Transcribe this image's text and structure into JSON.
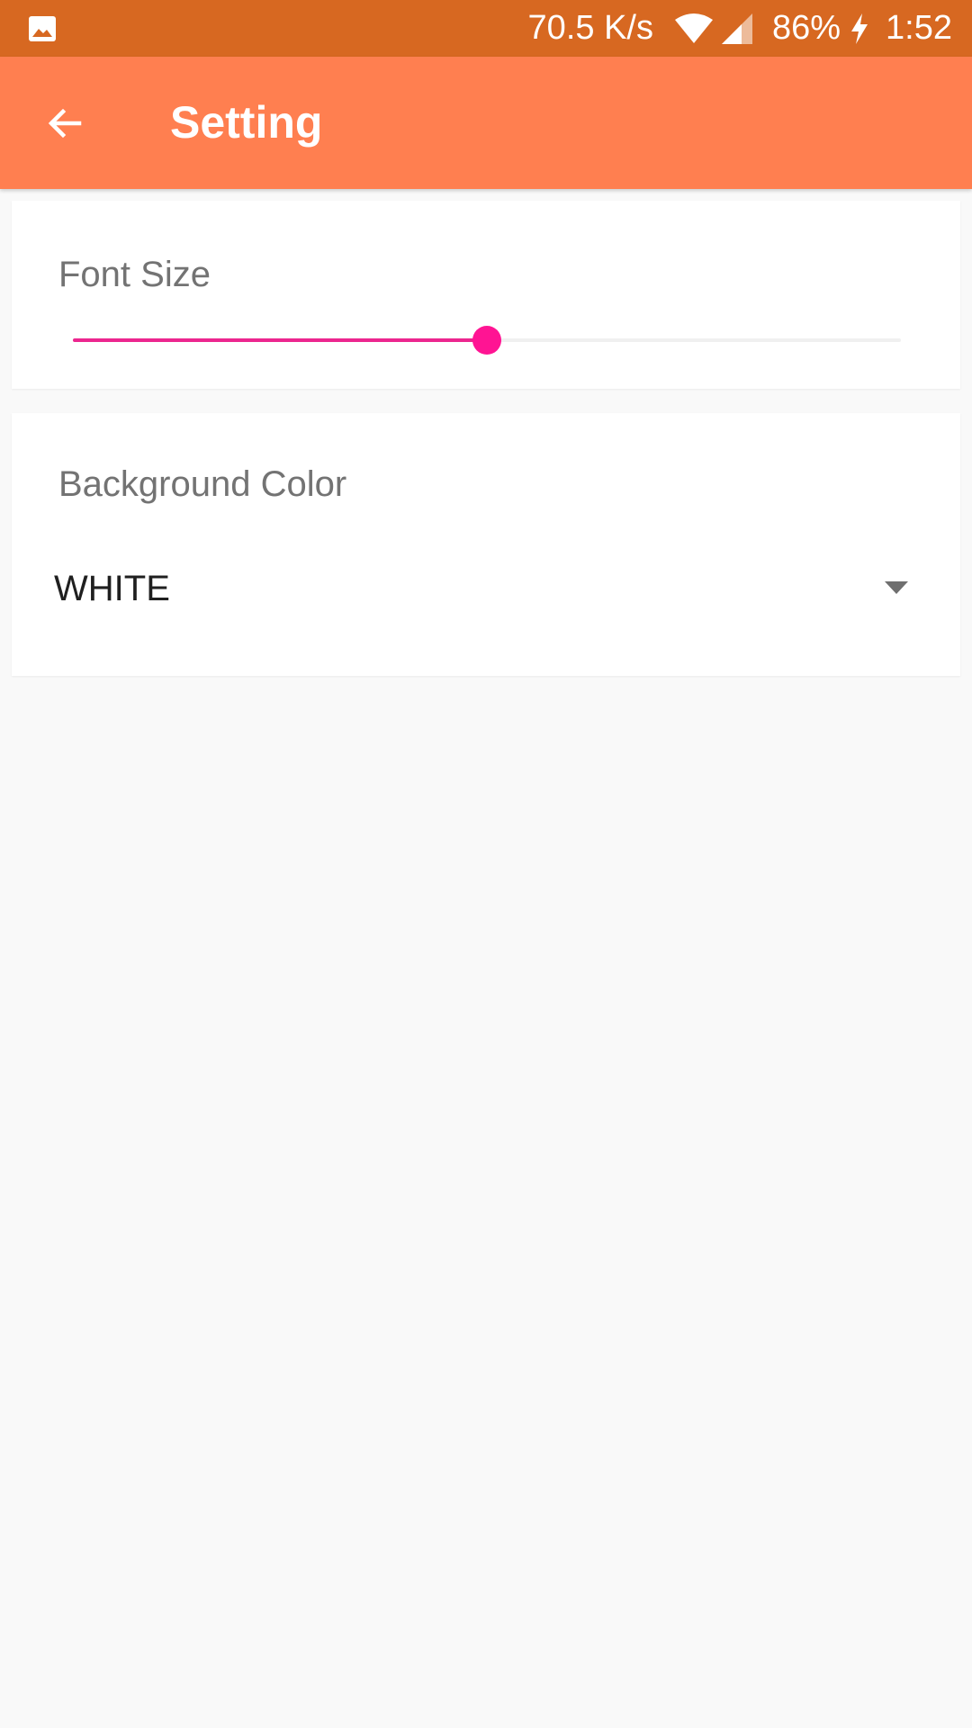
{
  "status_bar": {
    "net_speed": "70.5 K/s",
    "battery": "86%",
    "time": "1:52",
    "icons": [
      "gallery-icon",
      "wifi-icon",
      "signal-icon",
      "charging-icon"
    ]
  },
  "app_bar": {
    "title": "Setting",
    "back_icon": "arrow-left-icon"
  },
  "font_size": {
    "label": "Font Size",
    "slider_fraction": 0.5
  },
  "background_color": {
    "label": "Background Color",
    "selected": "WHITE",
    "dropdown_icon": "caret-down-icon"
  },
  "colors": {
    "status_bar": "#d76821",
    "app_bar": "#ff7f50",
    "accent": "#ff1493",
    "slider_fill": "#ec268f",
    "page_bg": "#f9f9f9"
  }
}
